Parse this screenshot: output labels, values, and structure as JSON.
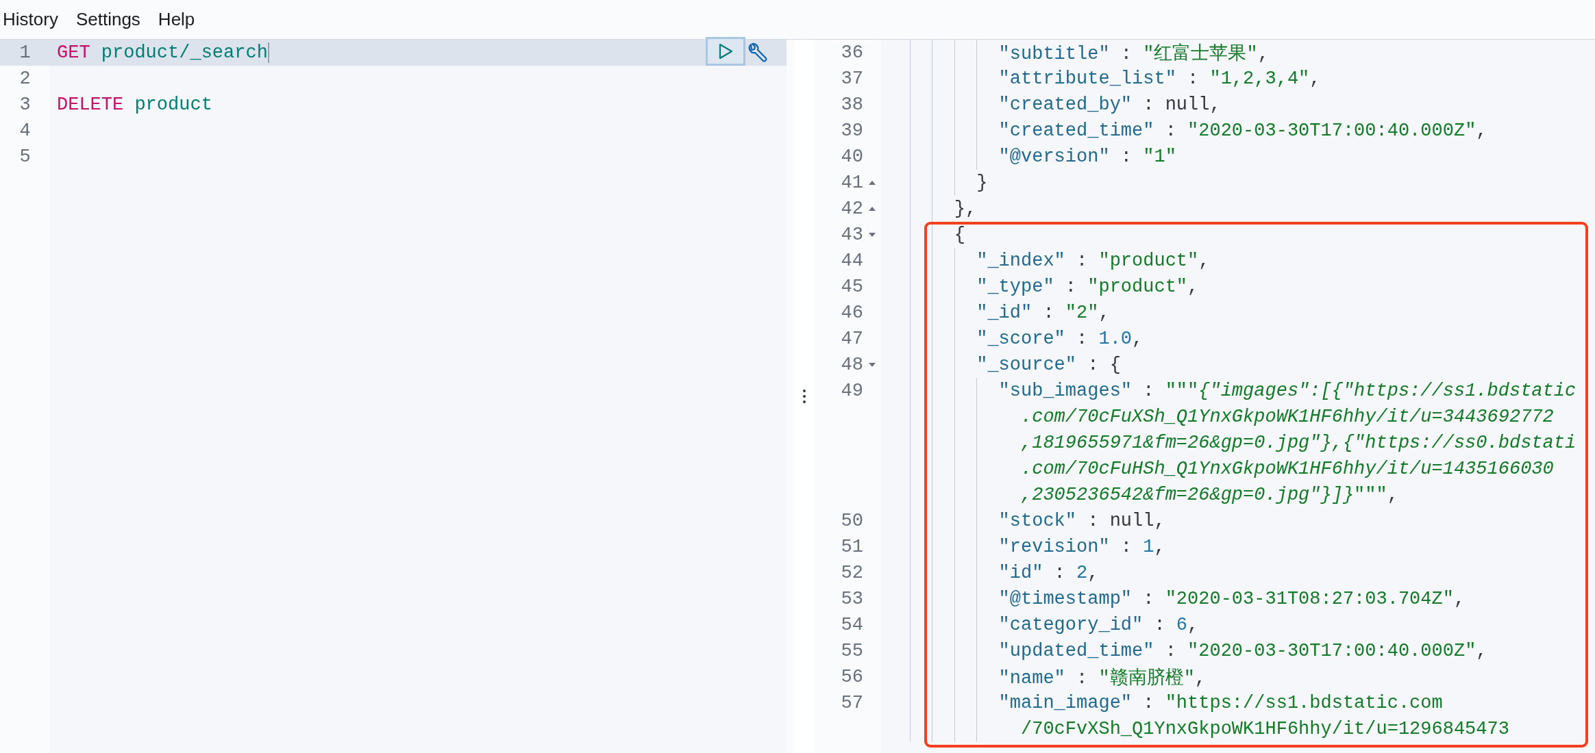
{
  "menu": [
    {
      "label": "History"
    },
    {
      "label": "Settings"
    },
    {
      "label": "Help"
    }
  ],
  "request": {
    "lines": [
      {
        "n": "1",
        "active": true,
        "tokens": [
          {
            "kind": "method",
            "text": "GET "
          },
          {
            "kind": "path",
            "text": "product/_search"
          }
        ]
      },
      {
        "n": "2",
        "active": false
      },
      {
        "n": "3",
        "active": false,
        "tokens": [
          {
            "kind": "method",
            "text": "DELETE "
          },
          {
            "kind": "path",
            "text": "product"
          }
        ]
      },
      {
        "n": "4",
        "active": false
      },
      {
        "n": "5",
        "active": false
      }
    ]
  },
  "response": {
    "lines": [
      {
        "children": [
          {
            "children": [
              {
                "n": "36",
                "boxed": false,
                "tokens": [
                  {
                    "kind": "key",
                    "text": "\"subtitle\""
                  },
                  {
                    "kind": "punct",
                    "text": " : "
                  },
                  {
                    "kind": "string",
                    "text": "\"红富士苹果\""
                  },
                  {
                    "kind": "punct",
                    "text": ","
                  }
                ]
              },
              {
                "n": "37",
                "boxed": false,
                "tokens": [
                  {
                    "kind": "key",
                    "text": "\"attribute_list\""
                  },
                  {
                    "kind": "punct",
                    "text": " : "
                  },
                  {
                    "kind": "string",
                    "text": "\"1,2,3,4\""
                  },
                  {
                    "kind": "punct",
                    "text": ","
                  }
                ]
              },
              {
                "n": "38",
                "boxed": false,
                "tokens": [
                  {
                    "kind": "key",
                    "text": "\"created_by\""
                  },
                  {
                    "kind": "punct",
                    "text": " : null,"
                  }
                ]
              },
              {
                "n": "39",
                "boxed": false,
                "tokens": [
                  {
                    "kind": "key",
                    "text": "\"created_time\""
                  },
                  {
                    "kind": "punct",
                    "text": " : "
                  },
                  {
                    "kind": "string",
                    "text": "\"2020-03-30T17:00:40.000Z\""
                  },
                  {
                    "kind": "punct",
                    "text": ","
                  }
                ]
              },
              {
                "n": "40",
                "boxed": false,
                "tokens": [
                  {
                    "kind": "key",
                    "text": "\"@version\""
                  },
                  {
                    "kind": "punct",
                    "text": " : "
                  },
                  {
                    "kind": "string",
                    "text": "\"1\""
                  }
                ]
              }
            ]
          },
          {
            "n": "41",
            "fold_open": false,
            "boxed": false,
            "tokens": [
              {
                "kind": "punct",
                "text": "}"
              }
            ]
          }
        ]
      },
      {
        "n": "42",
        "fold_open": false,
        "boxed": false,
        "tokens": [
          {
            "kind": "punct",
            "text": "},"
          }
        ]
      },
      {
        "n": "43",
        "fold_open": true,
        "boxed": true,
        "tokens": [
          {
            "kind": "punct",
            "text": "{"
          }
        ],
        "children": [
          {
            "n": "44",
            "boxed": true,
            "tokens": [
              {
                "kind": "key",
                "text": "\"_index\""
              },
              {
                "kind": "punct",
                "text": " : "
              },
              {
                "kind": "string",
                "text": "\"product\""
              },
              {
                "kind": "punct",
                "text": ","
              }
            ]
          },
          {
            "n": "45",
            "boxed": true,
            "tokens": [
              {
                "kind": "key",
                "text": "\"_type\""
              },
              {
                "kind": "punct",
                "text": " : "
              },
              {
                "kind": "string",
                "text": "\"product\""
              },
              {
                "kind": "punct",
                "text": ","
              }
            ]
          },
          {
            "n": "46",
            "boxed": true,
            "tokens": [
              {
                "kind": "key",
                "text": "\"_id\""
              },
              {
                "kind": "punct",
                "text": " : "
              },
              {
                "kind": "string",
                "text": "\"2\""
              },
              {
                "kind": "punct",
                "text": ","
              }
            ]
          },
          {
            "n": "47",
            "boxed": true,
            "tokens": [
              {
                "kind": "key",
                "text": "\"_score\""
              },
              {
                "kind": "punct",
                "text": " : "
              },
              {
                "kind": "number",
                "text": "1.0"
              },
              {
                "kind": "punct",
                "text": ","
              }
            ]
          },
          {
            "n": "48",
            "fold_open": true,
            "boxed": true,
            "tokens": [
              {
                "kind": "key",
                "text": "\"_source\""
              },
              {
                "kind": "punct",
                "text": " : {"
              }
            ],
            "children": [
              {
                "n": "49",
                "boxed": true,
                "tokens": [
                  {
                    "kind": "key",
                    "text": "\"sub_images\""
                  },
                  {
                    "kind": "punct",
                    "text": " : "
                  },
                  {
                    "kind": "string",
                    "text": "\"\"\""
                  },
                  {
                    "kind": "triple",
                    "text": "{\"imgages\":[{\"https://ss1.bdstatic"
                  }
                ],
                "wrap": [
                  [
                    {
                      "kind": "triple",
                      "text": ".com/70cFuXSh_Q1YnxGkpoWK1HF6hhy/it/u=3443692772"
                    }
                  ],
                  [
                    {
                      "kind": "triple",
                      "text": ",1819655971&fm=26&gp=0.jpg\"},{\"https://ss0.bdstati"
                    }
                  ],
                  [
                    {
                      "kind": "triple",
                      "text": ".com/70cFuHSh_Q1YnxGkpoWK1HF6hhy/it/u=1435166030"
                    }
                  ],
                  [
                    {
                      "kind": "triple",
                      "text": ",2305236542&fm=26&gp=0.jpg\"}]}"
                    },
                    {
                      "kind": "string",
                      "text": "\"\"\""
                    },
                    {
                      "kind": "punct",
                      "text": ","
                    }
                  ]
                ]
              },
              {
                "n": "50",
                "boxed": true,
                "tokens": [
                  {
                    "kind": "key",
                    "text": "\"stock\""
                  },
                  {
                    "kind": "punct",
                    "text": " : null,"
                  }
                ]
              },
              {
                "n": "51",
                "boxed": true,
                "tokens": [
                  {
                    "kind": "key",
                    "text": "\"revision\""
                  },
                  {
                    "kind": "punct",
                    "text": " : "
                  },
                  {
                    "kind": "number",
                    "text": "1"
                  },
                  {
                    "kind": "punct",
                    "text": ","
                  }
                ]
              },
              {
                "n": "52",
                "boxed": true,
                "tokens": [
                  {
                    "kind": "key",
                    "text": "\"id\""
                  },
                  {
                    "kind": "punct",
                    "text": " : "
                  },
                  {
                    "kind": "number",
                    "text": "2"
                  },
                  {
                    "kind": "punct",
                    "text": ","
                  }
                ]
              },
              {
                "n": "53",
                "boxed": true,
                "tokens": [
                  {
                    "kind": "key",
                    "text": "\"@timestamp\""
                  },
                  {
                    "kind": "punct",
                    "text": " : "
                  },
                  {
                    "kind": "string",
                    "text": "\"2020-03-31T08:27:03.704Z\""
                  },
                  {
                    "kind": "punct",
                    "text": ","
                  }
                ]
              },
              {
                "n": "54",
                "boxed": true,
                "tokens": [
                  {
                    "kind": "key",
                    "text": "\"category_id\""
                  },
                  {
                    "kind": "punct",
                    "text": " : "
                  },
                  {
                    "kind": "number",
                    "text": "6"
                  },
                  {
                    "kind": "punct",
                    "text": ","
                  }
                ]
              },
              {
                "n": "55",
                "boxed": true,
                "tokens": [
                  {
                    "kind": "key",
                    "text": "\"updated_time\""
                  },
                  {
                    "kind": "punct",
                    "text": " : "
                  },
                  {
                    "kind": "string",
                    "text": "\"2020-03-30T17:00:40.000Z\""
                  },
                  {
                    "kind": "punct",
                    "text": ","
                  }
                ]
              },
              {
                "n": "56",
                "boxed": true,
                "tokens": [
                  {
                    "kind": "key",
                    "text": "\"name\""
                  },
                  {
                    "kind": "punct",
                    "text": " : "
                  },
                  {
                    "kind": "string",
                    "text": "\"赣南脐橙\""
                  },
                  {
                    "kind": "punct",
                    "text": ","
                  }
                ]
              },
              {
                "n": "57",
                "boxed": true,
                "tokens": [
                  {
                    "kind": "key",
                    "text": "\"main_image\""
                  },
                  {
                    "kind": "punct",
                    "text": " : "
                  },
                  {
                    "kind": "string",
                    "text": "\"https://ss1.bdstatic.com"
                  }
                ],
                "wrap": [
                  [
                    {
                      "kind": "string",
                      "text": "/70cFvXSh_Q1YnxGkpoWK1HF6hhy/it/u=1296845473"
                    }
                  ]
                ]
              }
            ]
          }
        ]
      }
    ]
  }
}
